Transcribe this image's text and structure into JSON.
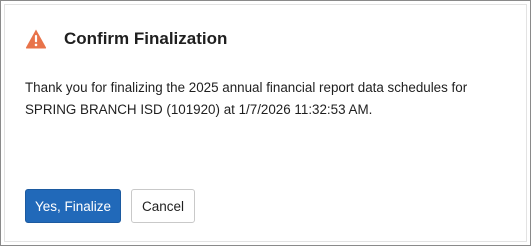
{
  "dialog": {
    "title": "Confirm Finalization",
    "icon": "warning-icon",
    "message_line_1": "Thank you for finalizing the 2025 annual financial report data schedules for",
    "message_line_2": "SPRING BRANCH ISD (101920) at 1/7/2026 11:32:53 AM.",
    "confirm_label": "Yes, Finalize",
    "cancel_label": "Cancel"
  },
  "colors": {
    "primary_button": "#2169b9",
    "warning_icon": "#e8734a"
  }
}
